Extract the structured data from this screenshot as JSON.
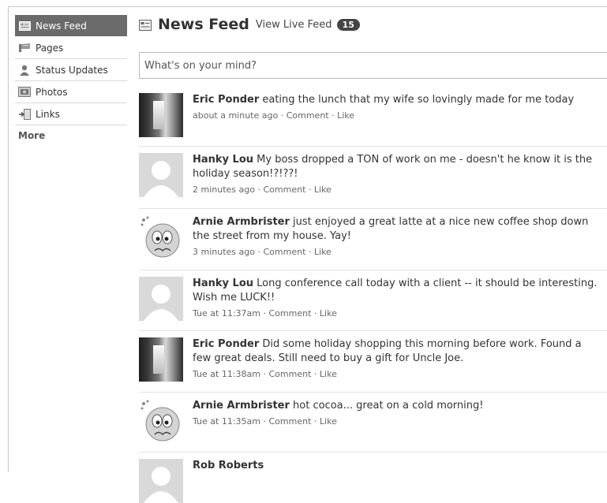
{
  "sidebar": {
    "items": [
      {
        "label": "News Feed",
        "icon": "news-feed-icon"
      },
      {
        "label": "Pages",
        "icon": "pages-icon"
      },
      {
        "label": "Status Updates",
        "icon": "status-updates-icon"
      },
      {
        "label": "Photos",
        "icon": "photos-icon"
      },
      {
        "label": "Links",
        "icon": "links-icon"
      }
    ],
    "more_label": "More"
  },
  "header": {
    "title": "News Feed",
    "live_link": "View Live Feed",
    "badge_count": "15"
  },
  "status_box": {
    "placeholder": "What's on your mind?"
  },
  "feed": {
    "comment_label": "Comment",
    "like_label": "Like",
    "stories": [
      {
        "name": "Eric Ponder",
        "text": "eating the lunch that my wife so lovingly made for me today",
        "time": "about a minute ago",
        "avatar": "photo"
      },
      {
        "name": "Hanky Lou",
        "text": "My boss dropped a TON of work on me - doesn't he know it is the holiday season!?!??!",
        "time": "2 minutes ago",
        "avatar": "blank"
      },
      {
        "name": "Arnie Armbrister",
        "text": "just enjoyed a great latte at a nice new coffee shop down the street from my house. Yay!",
        "time": "3 minutes ago",
        "avatar": "emoji"
      },
      {
        "name": "Hanky Lou",
        "text": "Long conference call today with a client -- it should be interesting. Wish me LUCK!!",
        "time": "Tue at 11:37am",
        "avatar": "blank"
      },
      {
        "name": "Eric Ponder",
        "text": "Did some holiday shopping this morning before work. Found a few great deals. Still need to buy a gift for Uncle Joe.",
        "time": "Tue at 11:38am",
        "avatar": "photo"
      },
      {
        "name": "Arnie Armbrister",
        "text": "hot cocoa... great on a cold morning!",
        "time": "Tue at 11:35am",
        "avatar": "emoji"
      },
      {
        "name": "Rob Roberts",
        "text": "",
        "time": "",
        "avatar": "blank"
      }
    ]
  }
}
